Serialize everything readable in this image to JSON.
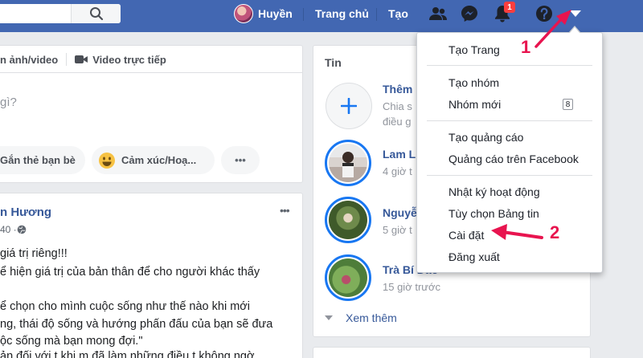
{
  "topbar": {
    "profile_name": "Huyền",
    "home_label": "Trang chủ",
    "create_label": "Tạo",
    "notification_count": "1"
  },
  "composer": {
    "tab_photo": "n ảnh/video",
    "tab_live": "Video trực tiếp",
    "prompt": "gì?",
    "tag_friends": "Gắn thẻ bạn bè",
    "feeling": "Cảm xúc/Hoạ...",
    "more": "•••"
  },
  "stories": {
    "title": "Tin",
    "add_title": "Thêm",
    "add_line1": "Chia s",
    "add_line2": "điều g",
    "items": [
      {
        "name": "Lam L",
        "time": "4 giờ t"
      },
      {
        "name": "Nguyễ",
        "time": "5 giờ t"
      },
      {
        "name": "Trà Bí Đao",
        "time": "15 giờ trước"
      }
    ],
    "see_more": "Xem thêm"
  },
  "post": {
    "author": "n Hương",
    "meta": "40 · ",
    "options": "•••",
    "lines": [
      "giá trị riêng!!!",
      "ể hiện giá trị của bản thân để cho người khác thấy",
      "",
      "ể chọn cho mình cuộc sống như thế nào khi mới",
      "ng, thái độ sống và hướng phấn đấu của bạn sẽ đưa",
      "ộc sống mà bạn mong đợi.\"",
      "ản đối với t khi m đã làm những điều t không ngờ"
    ]
  },
  "dropdown": {
    "items": [
      "Tạo Trang",
      "Tạo nhóm",
      "Nhóm mới",
      "Tạo quảng cáo",
      "Quảng cáo trên Facebook",
      "Nhật ký hoạt động",
      "Tùy chọn Bảng tin",
      "Cài đặt",
      "Đăng xuất"
    ],
    "new_groups_count": "8"
  },
  "annotations": {
    "step1": "1",
    "step2": "2"
  }
}
